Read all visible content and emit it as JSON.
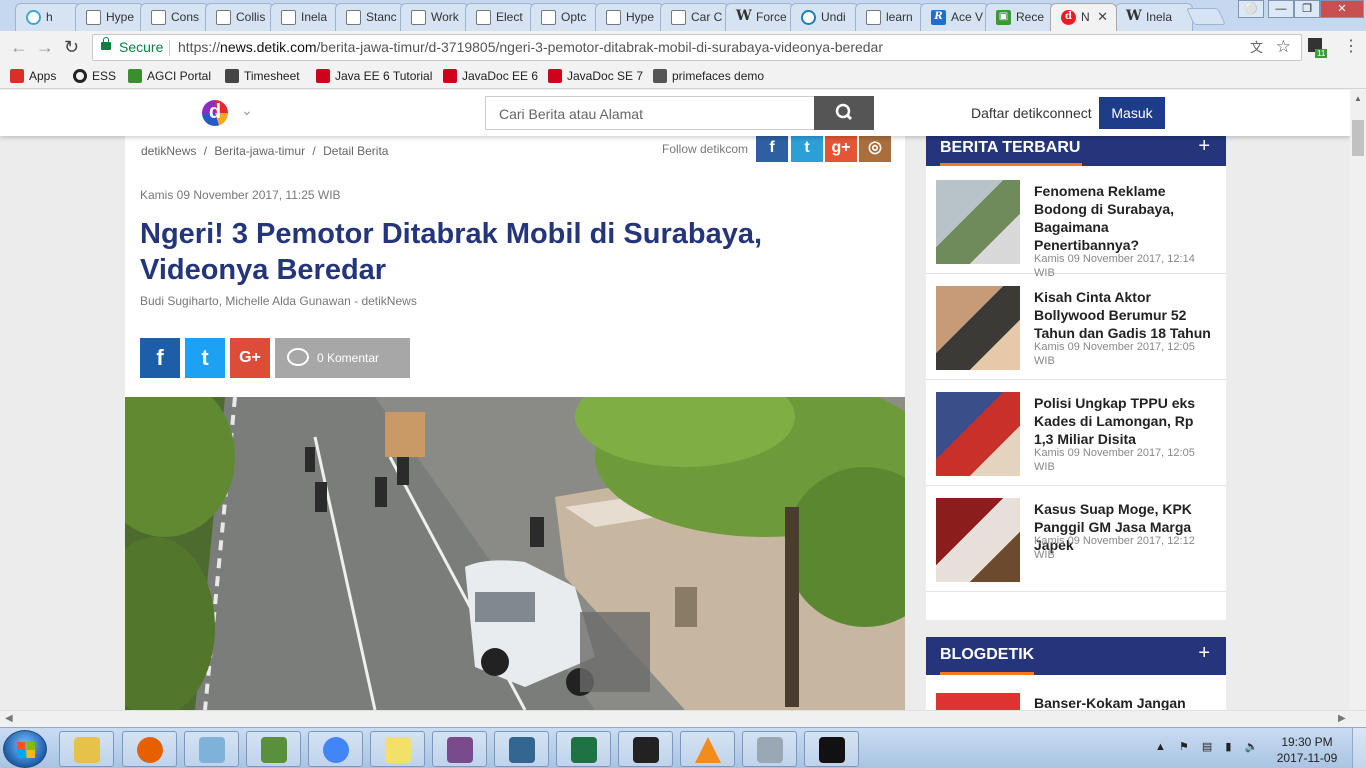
{
  "browser": {
    "tabs": [
      {
        "label": "h",
        "icon": "hyperledger-icon"
      },
      {
        "label": "Hype",
        "icon": "page-icon"
      },
      {
        "label": "Cons",
        "icon": "page-icon"
      },
      {
        "label": "Collis",
        "icon": "page-icon"
      },
      {
        "label": "Inela",
        "icon": "page-icon"
      },
      {
        "label": "Stanc",
        "icon": "page-icon"
      },
      {
        "label": "Work",
        "icon": "page-icon"
      },
      {
        "label": "Elect",
        "icon": "page-icon"
      },
      {
        "label": "Optc",
        "icon": "page-icon"
      },
      {
        "label": "Hype",
        "icon": "page-icon"
      },
      {
        "label": "Car C",
        "icon": "page-icon"
      },
      {
        "label": "Force",
        "icon": "wikipedia-icon"
      },
      {
        "label": "Undi",
        "icon": "udacity-icon"
      },
      {
        "label": "learn",
        "icon": "page-icon"
      },
      {
        "label": "Ace V",
        "icon": "r-icon"
      },
      {
        "label": "Rece",
        "icon": "green-app-icon"
      },
      {
        "label": "N",
        "icon": "detik-icon"
      },
      {
        "label": "Inela",
        "icon": "wikipedia-icon"
      }
    ],
    "active_tab": 16,
    "secure_label": "Secure",
    "url_prefix": "https://",
    "url_domain": "news.detik.com",
    "url_path": "/berita-jawa-timur/d-3719805/ngeri-3-pemotor-ditabrak-mobil-di-surabaya-videonya-beredar",
    "extension_badge": "11"
  },
  "bookmarks": [
    {
      "label": "Apps",
      "icon": "apps-grid-icon",
      "color": "#d93025"
    },
    {
      "label": "ESS",
      "icon": "ess-icon",
      "color": "#222222"
    },
    {
      "label": "AGCI Portal",
      "icon": "agci-icon",
      "color": "#3c8d2f"
    },
    {
      "label": "Timesheet",
      "icon": "timesheet-icon",
      "color": "#444444"
    },
    {
      "label": "Java EE 6 Tutorial",
      "icon": "oracle-icon",
      "color": "#d0021b"
    },
    {
      "label": "JavaDoc EE 6",
      "icon": "oracle-icon",
      "color": "#d0021b"
    },
    {
      "label": "JavaDoc SE 7",
      "icon": "oracle-icon",
      "color": "#d0021b"
    },
    {
      "label": "primefaces demo",
      "icon": "primefaces-icon",
      "color": "#555555"
    }
  ],
  "site": {
    "logo_letter": "d",
    "search_placeholder": "Cari Berita atau Alamat",
    "daftar": "Daftar detikconnect",
    "masuk": "Masuk"
  },
  "article": {
    "breadcrumb": [
      "detikNews",
      "Berita-jawa-timur",
      "Detail Berita"
    ],
    "breadcrumb_sep": "/",
    "follow": "Follow detikcom",
    "date": "Kamis 09 November 2017, 11:25 WIB",
    "title": "Ngeri! 3 Pemotor Ditabrak Mobil di Surabaya, Videonya Beredar",
    "author": "Budi Sugiharto, Michelle Alda Gunawan - detikNews",
    "share": [
      {
        "glyph": "f",
        "icon": "facebook-icon",
        "color": "#1c5fa8"
      },
      {
        "glyph": "t",
        "icon": "twitter-icon",
        "color": "#1da1f2"
      },
      {
        "glyph": "G+",
        "icon": "google-plus-icon",
        "color": "#dd4b39"
      }
    ],
    "komentar": "0 Komentar",
    "follow_icons": [
      {
        "glyph": "f",
        "icon": "facebook-icon",
        "color": "#2d5fa2"
      },
      {
        "glyph": "t",
        "icon": "twitter-icon",
        "color": "#2b9fd8"
      },
      {
        "glyph": "g+",
        "icon": "google-plus-icon",
        "color": "#e45633"
      },
      {
        "glyph": "◎",
        "icon": "instagram-icon",
        "color": "#a96e3c"
      }
    ]
  },
  "sidebar": {
    "terbaru_title": "BERITA TERBARU",
    "blog_title": "BLOGDETIK",
    "plus": "+",
    "items": [
      {
        "title": "Fenomena Reklame Bodong di Surabaya, Bagaimana Penertibannya?",
        "date": "Kamis 09 November 2017, 12:14 WIB"
      },
      {
        "title": "Kisah Cinta Aktor Bollywood Berumur 52 Tahun dan Gadis 18 Tahun",
        "date": "Kamis 09 November 2017, 12:05 WIB"
      },
      {
        "title": "Polisi Ungkap TPPU eks Kades di Lamongan, Rp 1,3 Miliar Disita",
        "date": "Kamis 09 November 2017, 12:05 WIB"
      },
      {
        "title": "Kasus Suap Moge, KPK Panggil GM Jasa Marga Japek",
        "date": "Kamis 09 November 2017, 12:12 WIB"
      }
    ],
    "blog_items": [
      {
        "title": "Banser-Kokam Jangan"
      }
    ]
  },
  "taskbar": {
    "apps": [
      {
        "icon": "file-explorer-icon",
        "color": "#e8c14a"
      },
      {
        "icon": "firefox-icon",
        "color": "#e66000"
      },
      {
        "icon": "notepad-icon",
        "color": "#7fb2d9"
      },
      {
        "icon": "chart-app-icon",
        "color": "#5a8f3c"
      },
      {
        "icon": "chrome-icon",
        "color": "#4285f4"
      },
      {
        "icon": "sticky-notes-icon",
        "color": "#f2e06b"
      },
      {
        "icon": "java-ee-ide-icon",
        "color": "#7a4b8c"
      },
      {
        "icon": "postgresql-icon",
        "color": "#336791"
      },
      {
        "icon": "excel-icon",
        "color": "#1f7244"
      },
      {
        "icon": "inkscape-icon",
        "color": "#222222"
      },
      {
        "icon": "vlc-icon",
        "color": "#f28c1b"
      },
      {
        "icon": "calculator-icon",
        "color": "#9aa7b5"
      },
      {
        "icon": "command-prompt-icon",
        "color": "#111111"
      }
    ],
    "time": "19:30 PM",
    "date": "2017-11-09"
  }
}
